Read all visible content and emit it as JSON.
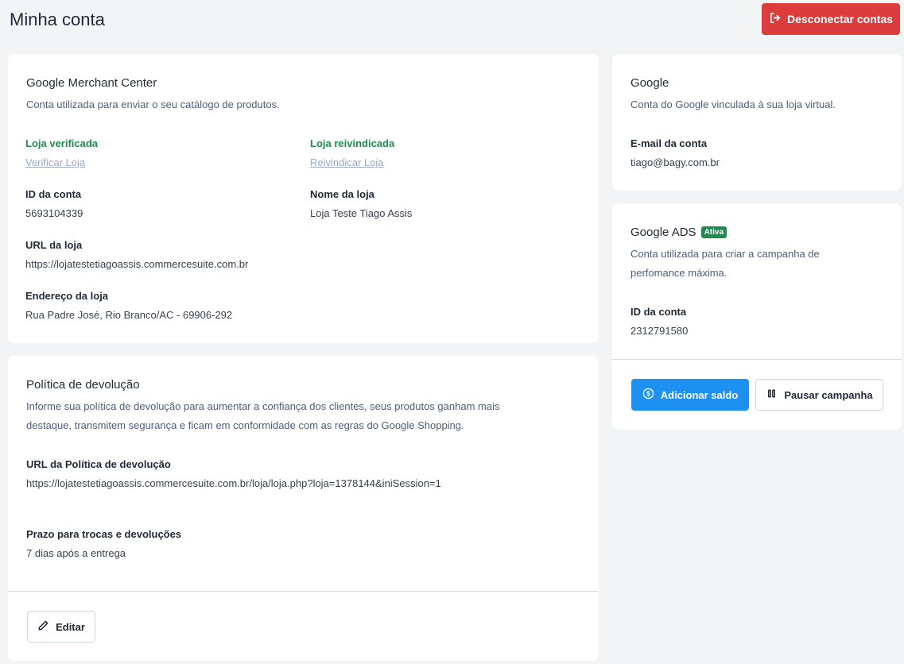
{
  "header": {
    "title": "Minha conta",
    "disconnect_label": "Desconectar contas"
  },
  "merchant": {
    "title": "Google Merchant Center",
    "subtitle": "Conta utilizada para enviar o seu catálogo de produtos.",
    "verified_label": "Loja verificada",
    "verify_link": "Verificar Loja",
    "claimed_label": "Loja reivindicada",
    "claim_link": "Reivindicar Loja",
    "account_id_label": "ID da conta",
    "account_id": "5693104339",
    "store_name_label": "Nome da loja",
    "store_name": "Loja Teste Tiago Assis",
    "store_url_label": "URL da loja",
    "store_url": "https://lojatestetiagoassis.commercesuite.com.br",
    "address_label": "Endereço da loja",
    "address": "Rua Padre José, Rio Branco/AC - 69906-292"
  },
  "policy": {
    "title": "Política de devolução",
    "description_line1": "Informe sua política de devolução para aumentar a confiança dos clientes, seus produtos ganham mais",
    "description_line2": "destaque, transmitem segurança e ficam em conformidade com as regras do Google Shopping.",
    "url_label": "URL da Política de devolução",
    "url": "https://lojatestetiagoassis.commercesuite.com.br/loja/loja.php?loja=1378144&iniSession=1",
    "deadline_label": "Prazo para trocas e devoluções",
    "deadline": "7 dias após a entrega",
    "edit_label": "Editar"
  },
  "google": {
    "title": "Google",
    "subtitle": "Conta do Google vinculada à sua loja virtual.",
    "email_label": "E-mail da conta",
    "email": "tiago@bagy.com.br"
  },
  "ads": {
    "title": "Google ADS",
    "badge": "Ativa",
    "subtitle_line1": "Conta utilizada para criar a campanha de",
    "subtitle_line2": "perfomance máxima.",
    "account_id_label": "ID da conta",
    "account_id": "2312791580",
    "add_balance_label": "Adicionar saldo",
    "pause_label": "Pausar campanha"
  },
  "colors": {
    "danger": "#dc3c3c",
    "primary": "#1e90f0",
    "success": "#1e8a4d"
  },
  "icons": [
    "logout-icon",
    "dollar-circle-icon",
    "pause-icon",
    "pencil-icon"
  ]
}
